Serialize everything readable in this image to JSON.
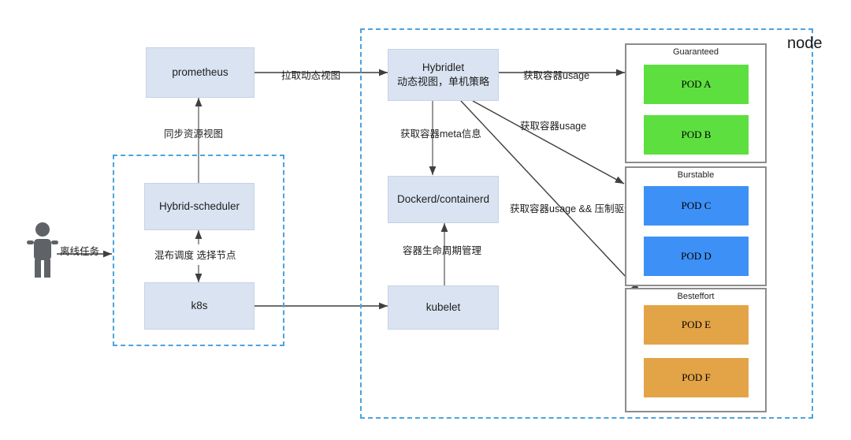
{
  "diagram": {
    "title": "Hybrid deployment node architecture",
    "colors": {
      "component_fill": "#d9e3f1",
      "component_border": "#c6d3e6",
      "zone_border": "#4ba3dd",
      "qos_border": "#8c8c8c",
      "pod_guaranteed": "#5de03f",
      "pod_burstable": "#3d90f5",
      "pod_besteffort": "#e3a448",
      "arrow": "#3f3f3f",
      "actor": "#5f6368"
    }
  },
  "zones": {
    "cluster": {
      "label": ""
    },
    "node": {
      "label": "node"
    }
  },
  "components": {
    "prometheus": {
      "label": "prometheus"
    },
    "hybrid_scheduler": {
      "label": "Hybrid-scheduler"
    },
    "k8s": {
      "label": "k8s"
    },
    "hybridlet": {
      "line1": "Hybridlet",
      "line2": "动态视图，单机策略"
    },
    "dockerd": {
      "label": "Dockerd/containerd"
    },
    "kubelet": {
      "label": "kubelet"
    }
  },
  "actor": {
    "label": "离线任务"
  },
  "edges": {
    "pull_dynamic_view": {
      "label": "拉取动态视图"
    },
    "sync_resource_view": {
      "label": "同步资源视图"
    },
    "hybrid_schedule_select_node": {
      "label": "混布调度 选择节点"
    },
    "container_meta": {
      "label": "获取容器meta信息"
    },
    "container_lifecycle": {
      "label": "容器生命周期管理"
    },
    "usage_guaranteed": {
      "label": "获取容器usage"
    },
    "usage_burstable": {
      "label": "获取容器usage"
    },
    "usage_evict_besteffort": {
      "label": "获取容器usage && 压制驱逐"
    }
  },
  "qos_groups": [
    {
      "name": "Guaranteed",
      "color": "#5de03f",
      "pods": [
        {
          "label": "POD A"
        },
        {
          "label": "POD B"
        }
      ]
    },
    {
      "name": "Burstable",
      "color": "#3d90f5",
      "pods": [
        {
          "label": "POD C"
        },
        {
          "label": "POD D"
        }
      ]
    },
    {
      "name": "Besteffort",
      "color": "#e3a448",
      "pods": [
        {
          "label": "POD E"
        },
        {
          "label": "POD F"
        }
      ]
    }
  ]
}
